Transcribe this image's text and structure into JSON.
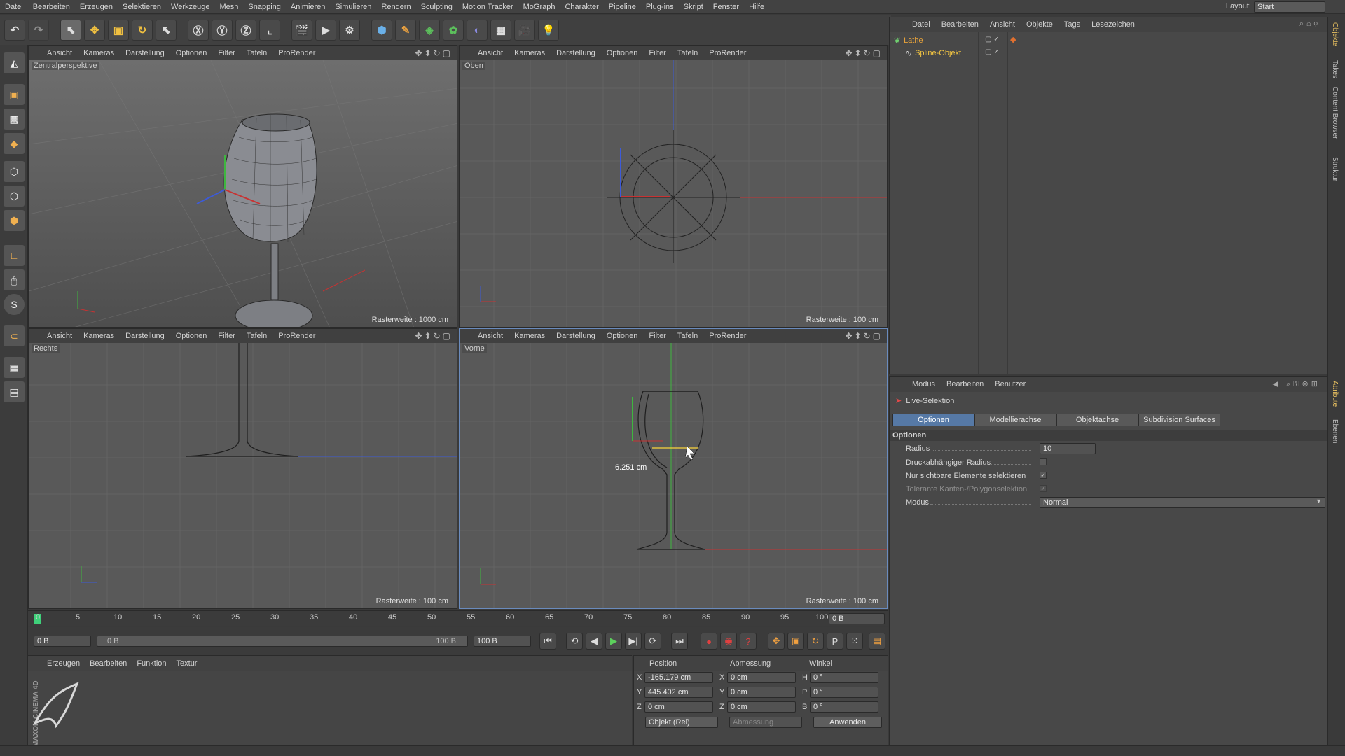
{
  "menubar": {
    "items": [
      "Datei",
      "Bearbeiten",
      "Erzeugen",
      "Selektieren",
      "Werkzeuge",
      "Mesh",
      "Snapping",
      "Animieren",
      "Simulieren",
      "Rendern",
      "Sculpting",
      "Motion Tracker",
      "MoGraph",
      "Charakter",
      "Pipeline",
      "Plug-ins",
      "Skript",
      "Fenster",
      "Hilfe"
    ],
    "layout_label": "Layout:",
    "layout_value": "Start"
  },
  "viewport_menu": [
    "Ansicht",
    "Kameras",
    "Darstellung",
    "Optionen",
    "Filter",
    "Tafeln",
    "ProRender"
  ],
  "viewports": {
    "persp": {
      "label": "Zentralperspektive",
      "raster": "Rasterweite : 1000 cm"
    },
    "top": {
      "label": "Oben",
      "raster": "Rasterweite : 100 cm"
    },
    "right": {
      "label": "Rechts",
      "raster": "Rasterweite : 100 cm"
    },
    "front": {
      "label": "Vorne",
      "raster": "Rasterweite : 100 cm",
      "measure": "6.251 cm"
    }
  },
  "timeline": {
    "ticks": [
      "0",
      "5",
      "10",
      "15",
      "20",
      "25",
      "30",
      "35",
      "40",
      "45",
      "50",
      "55",
      "60",
      "65",
      "70",
      "75",
      "80",
      "85",
      "90",
      "95",
      "100"
    ],
    "current_frame": "0 B",
    "start_field": "0 B",
    "range_start": "0 B",
    "range_end": "100 B",
    "end_field": "100 B"
  },
  "material_panel": {
    "menu": [
      "Erzeugen",
      "Bearbeiten",
      "Funktion",
      "Textur"
    ],
    "brand": "MAXON CINEMA 4D"
  },
  "coord_panel": {
    "headers": [
      "Position",
      "Abmessung",
      "Winkel"
    ],
    "rows": [
      {
        "axis": "X",
        "pos": "-165.179 cm",
        "dim_axis": "X",
        "dim": "0 cm",
        "ang_axis": "H",
        "ang": "0 °"
      },
      {
        "axis": "Y",
        "pos": "445.402 cm",
        "dim_axis": "Y",
        "dim": "0 cm",
        "ang_axis": "P",
        "ang": "0 °"
      },
      {
        "axis": "Z",
        "pos": "0 cm",
        "dim_axis": "Z",
        "dim": "0 cm",
        "ang_axis": "B",
        "ang": "0 °"
      }
    ],
    "mode_select": "Objekt (Rel)",
    "dim_select": "Abmessung",
    "apply": "Anwenden"
  },
  "object_manager": {
    "menu": [
      "Datei",
      "Bearbeiten",
      "Ansicht",
      "Objekte",
      "Tags",
      "Lesezeichen"
    ],
    "objects": [
      {
        "name": "Lathe",
        "color": "#e8a33a"
      },
      {
        "name": "Spline-Objekt",
        "color": "#f3c542"
      }
    ]
  },
  "attribute_manager": {
    "menu": [
      "Modus",
      "Bearbeiten",
      "Benutzer"
    ],
    "tool": "Live-Selektion",
    "tabs": [
      "Optionen",
      "Modellierachse",
      "Objektachse",
      "Subdivision Surfaces"
    ],
    "section": "Optionen",
    "rows": {
      "radius_label": "Radius",
      "radius_value": "10",
      "pressure_label": "Druckabhängiger Radius",
      "visible_label": "Nur sichtbare Elemente selektieren",
      "tolerant_label": "Tolerante Kanten-/Polygonselektion",
      "mode_label": "Modus",
      "mode_value": "Normal"
    }
  },
  "right_tabs": [
    "Objekte",
    "Takes",
    "Content Browser",
    "Struktur",
    "Attribute",
    "Ebenen"
  ],
  "colors": {
    "accent": "#5679a6",
    "x_axis": "#c83232",
    "y_axis": "#3fb63f",
    "z_axis": "#3d5bd8"
  }
}
